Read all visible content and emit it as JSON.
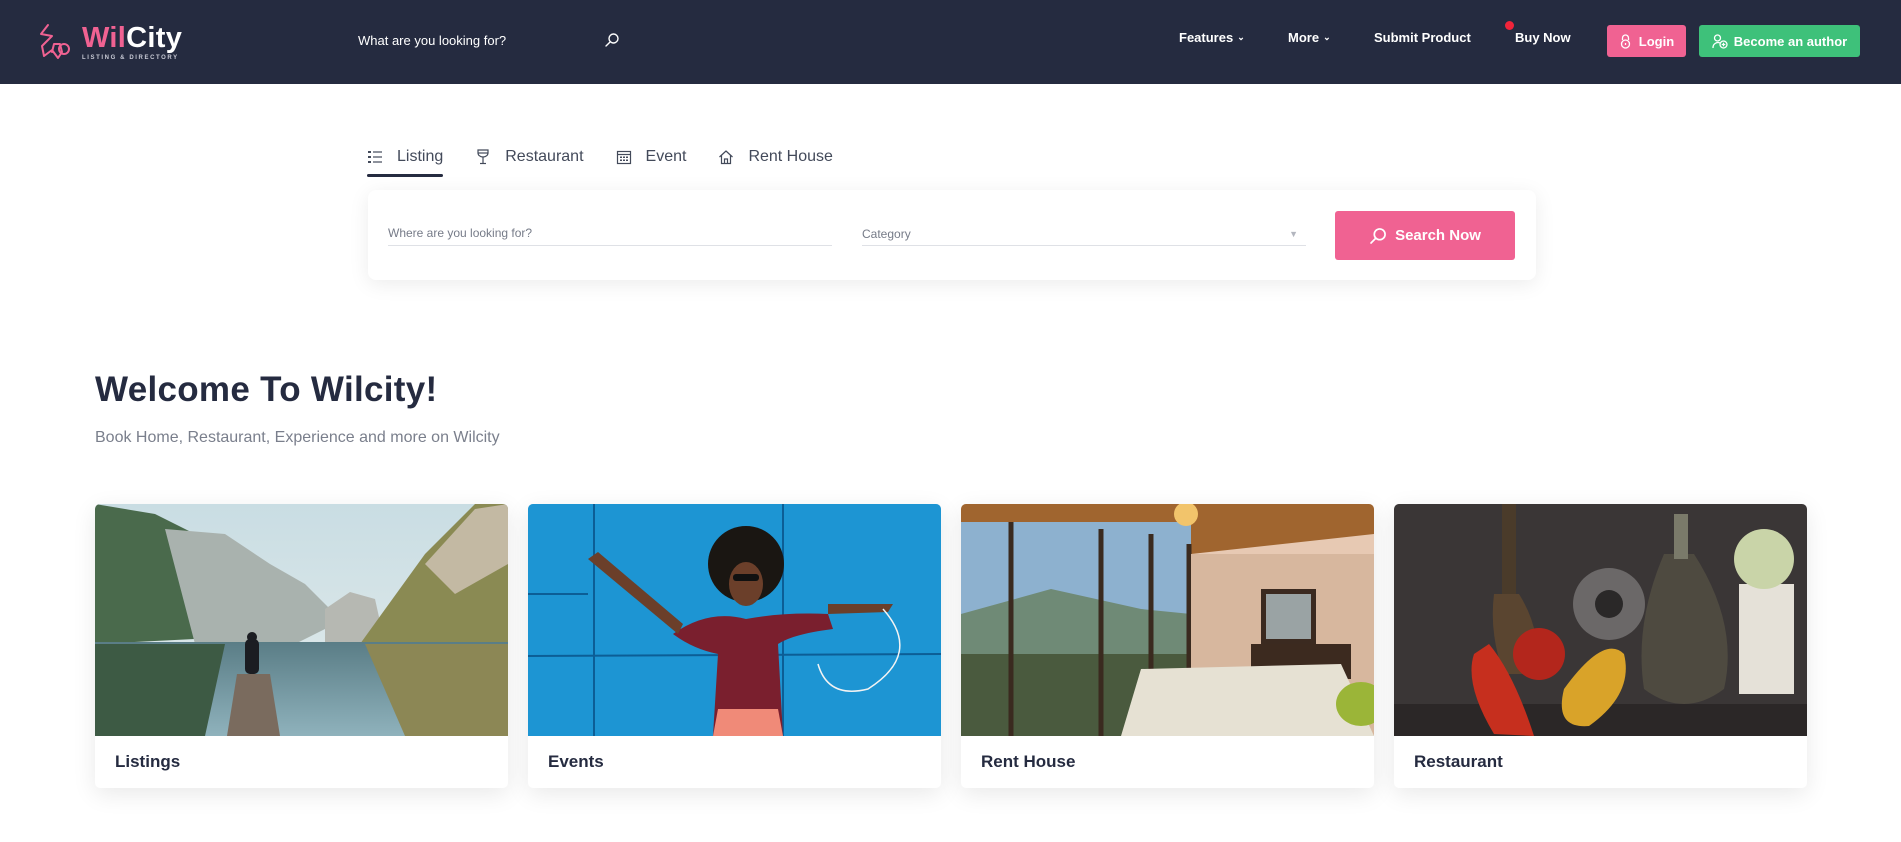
{
  "header": {
    "logo": {
      "brand_part1": "Wil",
      "brand_part2": "City",
      "tagline": "LISTING & DIRECTORY"
    },
    "search": {
      "placeholder": "What are you looking for?",
      "icon": "search-icon"
    },
    "nav": [
      {
        "label": "Features",
        "icon": "chevron-down-icon"
      },
      {
        "label": "More",
        "icon": "chevron-down-icon"
      },
      {
        "label": "Submit Product"
      },
      {
        "label": "Buy Now",
        "badge": "notification-dot"
      }
    ],
    "login_button": {
      "label": "Login",
      "icon": "lock-icon"
    },
    "author_button": {
      "label": "Become an author",
      "icon": "user-plus-icon"
    },
    "colors": {
      "background": "#252b40",
      "accent": "#f06292",
      "success": "#3ec17a",
      "badge": "#f1243a"
    }
  },
  "search_tabs": [
    {
      "label": "Listing",
      "icon": "list-icon",
      "active": true
    },
    {
      "label": "Restaurant",
      "icon": "wine-glass-icon",
      "active": false
    },
    {
      "label": "Event",
      "icon": "calendar-icon",
      "active": false
    },
    {
      "label": "Rent House",
      "icon": "home-icon",
      "active": false
    }
  ],
  "search_form": {
    "where_placeholder": "Where are you looking for?",
    "where_value": "",
    "category_selected": "Category",
    "submit_label": "Search Now"
  },
  "hero": {
    "title": "Welcome To Wilcity!",
    "subtitle": "Book Home, Restaurant, Experience and more on Wilcity"
  },
  "categories": [
    {
      "title": "Listings",
      "image": "mountain-lake-photo"
    },
    {
      "title": "Events",
      "image": "dancing-woman-photo"
    },
    {
      "title": "Rent House",
      "image": "bedroom-photo"
    },
    {
      "title": "Restaurant",
      "image": "still-life-photo"
    }
  ]
}
